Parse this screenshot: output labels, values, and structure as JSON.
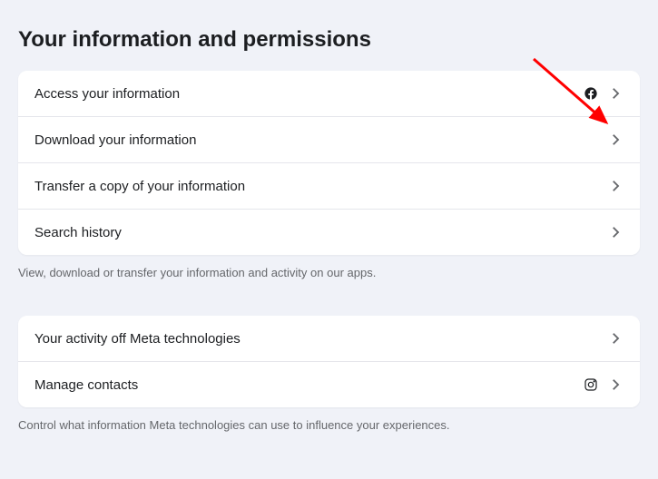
{
  "page": {
    "title": "Your information and permissions"
  },
  "group1": {
    "items": [
      {
        "label": "Access your information",
        "platform": "facebook"
      },
      {
        "label": "Download your information",
        "platform": null
      },
      {
        "label": "Transfer a copy of your information",
        "platform": null
      },
      {
        "label": "Search history",
        "platform": null
      }
    ],
    "caption": "View, download or transfer your information and activity on our apps."
  },
  "group2": {
    "items": [
      {
        "label": "Your activity off Meta technologies",
        "platform": null
      },
      {
        "label": "Manage contacts",
        "platform": "instagram"
      }
    ],
    "caption": "Control what information Meta technologies can use to influence your experiences."
  },
  "annotation": {
    "arrow_color": "#ff0000"
  }
}
